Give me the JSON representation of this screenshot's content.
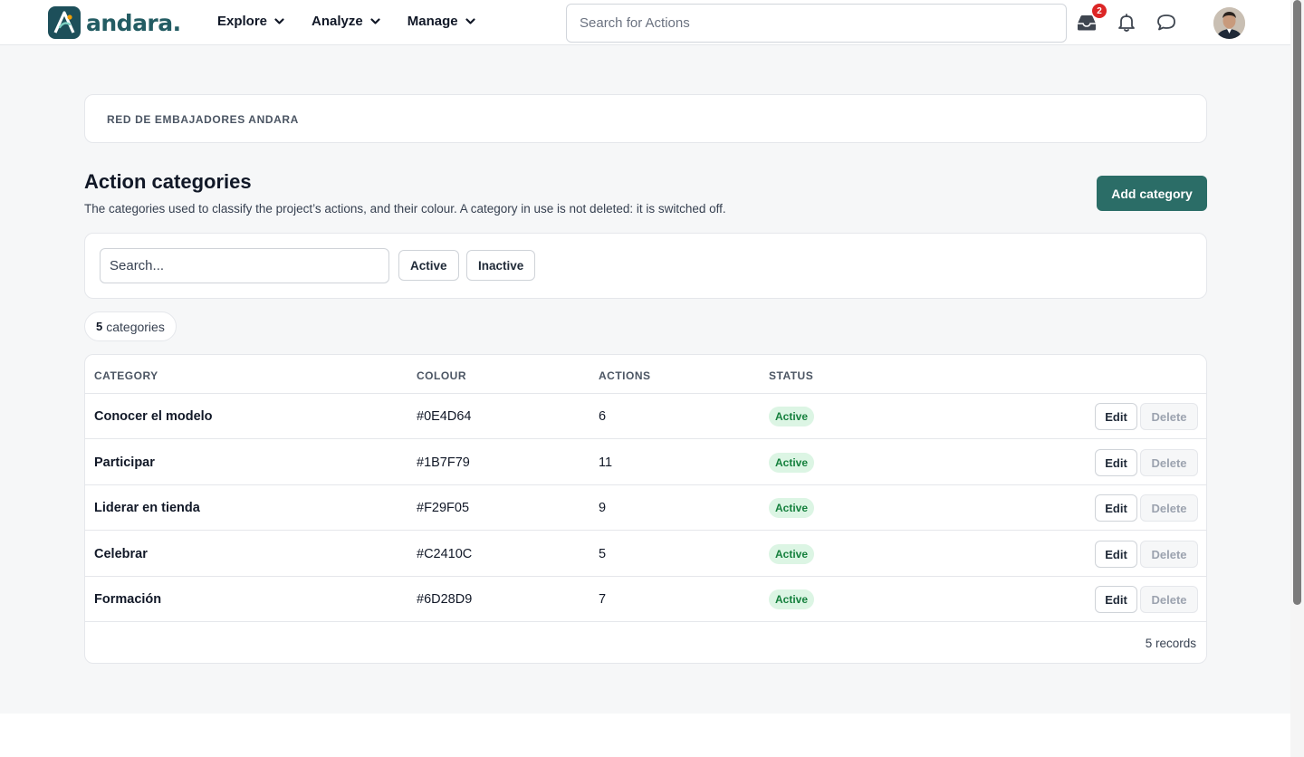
{
  "app": {
    "name": "andara."
  },
  "nav": [
    {
      "label": "Explore"
    },
    {
      "label": "Analyze"
    },
    {
      "label": "Manage"
    }
  ],
  "top_search": {
    "placeholder": "Search for Actions"
  },
  "inbox": {
    "badge": "2",
    "icon": "inbox-icon"
  },
  "icons": {
    "bell": "bell-icon",
    "chat": "chat-icon"
  },
  "breadcrumb": "RED DE EMBAJADORES ANDARA",
  "page": {
    "title": "Action categories",
    "description": "The categories used to classify the project’s actions, and their colour. A category in use is not deleted: it is switched off.",
    "add_button": "Add category"
  },
  "filter": {
    "placeholder": "Search...",
    "chips": [
      "Active",
      "Inactive"
    ]
  },
  "count": {
    "value": "5",
    "label": "categories"
  },
  "table": {
    "headers": [
      "CATEGORY",
      "COLOUR",
      "ACTIONS",
      "STATUS"
    ],
    "rows": [
      {
        "category": "Conocer el modelo",
        "colour": "#0E4D64",
        "actions": "6",
        "status": "Active"
      },
      {
        "category": "Participar",
        "colour": "#1B7F79",
        "actions": "11",
        "status": "Active"
      },
      {
        "category": "Liderar en tienda",
        "colour": "#F29F05",
        "actions": "9",
        "status": "Active"
      },
      {
        "category": "Celebrar",
        "colour": "#C2410C",
        "actions": "5",
        "status": "Active"
      },
      {
        "category": "Formación",
        "colour": "#6D28D9",
        "actions": "7",
        "status": "Active"
      }
    ],
    "edit_label": "Edit",
    "delete_label": "Delete",
    "footer": "5 records"
  },
  "colors": {
    "brand": "#235c63",
    "primary_button": "#2b6d67",
    "badge": "#dc2626",
    "status_bg": "#dcf5e4",
    "status_text": "#15803d"
  }
}
